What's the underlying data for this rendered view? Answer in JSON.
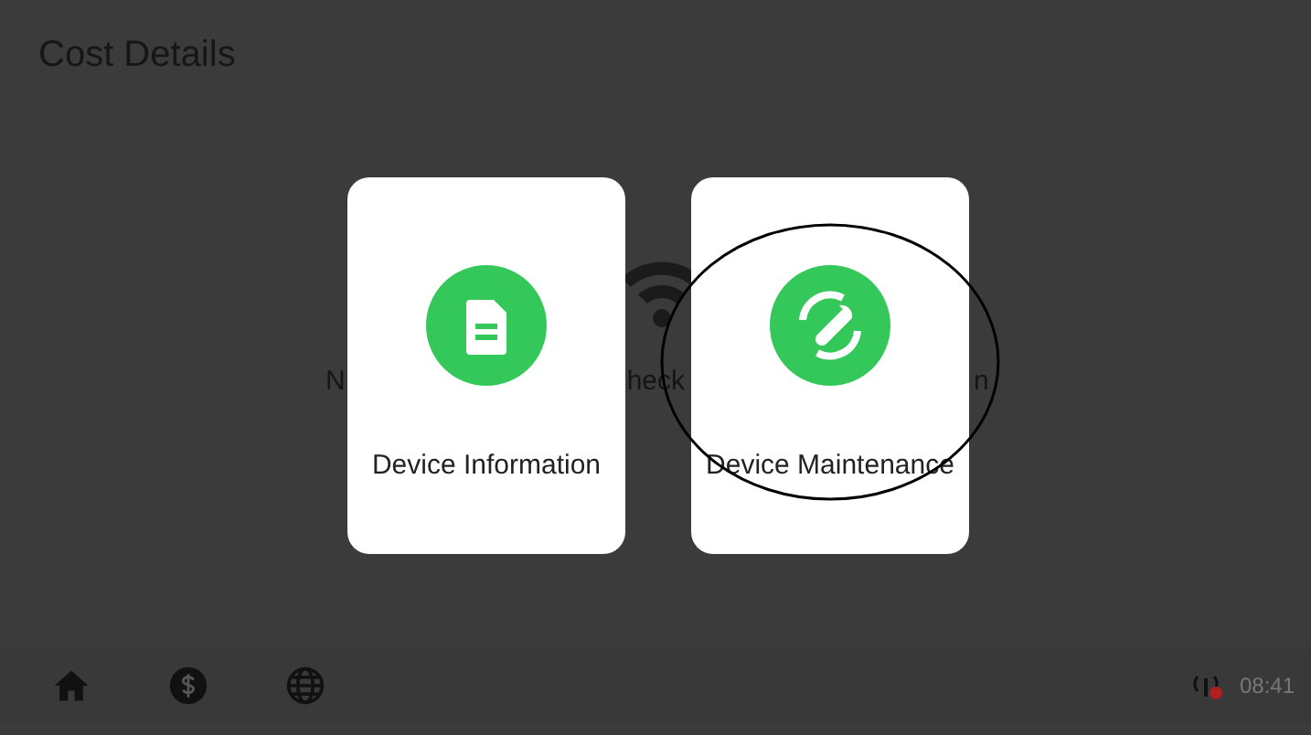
{
  "header": {
    "title": "Cost Details"
  },
  "background_message": {
    "fragments": [
      "N",
      "heck",
      "n"
    ]
  },
  "cards": [
    {
      "label": "Device Information",
      "kind": "document",
      "circled": false
    },
    {
      "label": "Device Maintenance",
      "kind": "maintenance",
      "circled": true
    }
  ],
  "bottom_bar": {
    "nav": [
      {
        "kind": "home"
      },
      {
        "kind": "dollar"
      },
      {
        "kind": "globe"
      }
    ],
    "signal_error": true,
    "time": "08:41"
  }
}
